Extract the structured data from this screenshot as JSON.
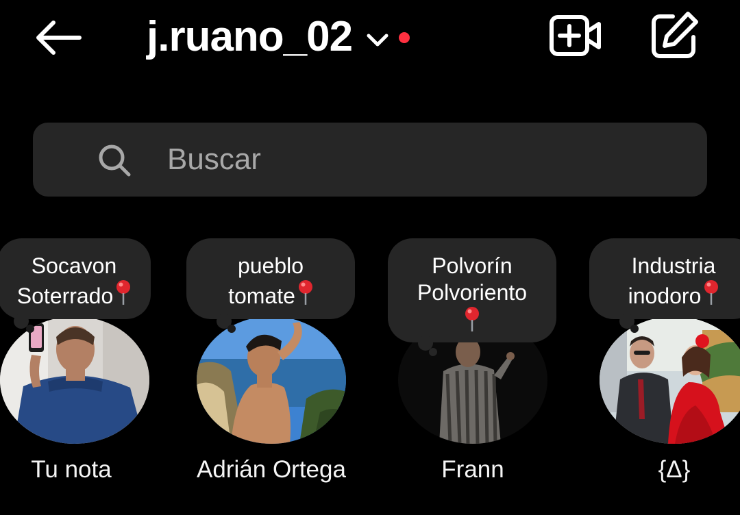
{
  "header": {
    "username": "j.ruano_02",
    "back_icon": "arrow-left-icon",
    "video_icon": "video-call-plus-icon",
    "compose_icon": "edit-pencil-icon",
    "unread_dot_color": "#ff3040"
  },
  "search": {
    "placeholder": "Buscar",
    "icon": "search-icon"
  },
  "notes": [
    {
      "note_line1": "Socavon",
      "note_line2": "Soterrado",
      "name": "Tu nota"
    },
    {
      "note_line1": "pueblo",
      "note_line2": "tomate",
      "name": "Adrián Ortega"
    },
    {
      "note_line1": "Polvorín",
      "note_line2": "Polvoriento",
      "name": "Frann"
    },
    {
      "note_line1": "Industria",
      "note_line2": "inodoro",
      "name": "{Δ}"
    }
  ],
  "colors": {
    "background": "#000000",
    "surface": "#262626",
    "placeholder": "#a8a8a8",
    "pin_red": "#e0262e"
  }
}
